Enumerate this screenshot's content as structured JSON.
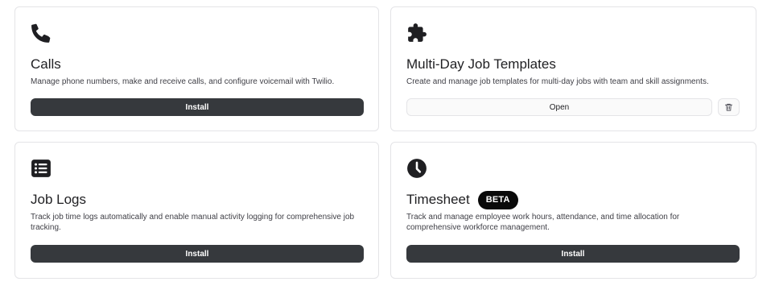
{
  "cards": [
    {
      "icon": "phone-icon",
      "title": "Calls",
      "description_lines": [
        "Manage phone numbers, make and receive calls, and configure voicemail with Twilio."
      ],
      "install_label": "Install"
    },
    {
      "icon": "puzzle-piece-icon",
      "title": "Multi-Day Job Templates",
      "description_lines": [
        "Create and manage job templates for multi-day jobs with team and skill assignments."
      ],
      "open_label": "Open",
      "delete_icon": "trash-icon"
    },
    {
      "icon": "list-icon",
      "title": "Job Logs",
      "description_lines": [
        "Track job time logs automatically and enable manual activity logging for comprehensive job",
        "tracking."
      ],
      "install_label": "Install"
    },
    {
      "icon": "clock-icon",
      "title": "Timesheet",
      "badge": "BETA",
      "description_lines": [
        "Track and manage employee work hours, attendance, and time allocation for",
        "comprehensive workforce management."
      ],
      "install_label": "Install"
    }
  ],
  "colors": {
    "install_button": "#36393d",
    "card_border": "#e4e4e7",
    "badge_bg": "#0a0a0a"
  }
}
